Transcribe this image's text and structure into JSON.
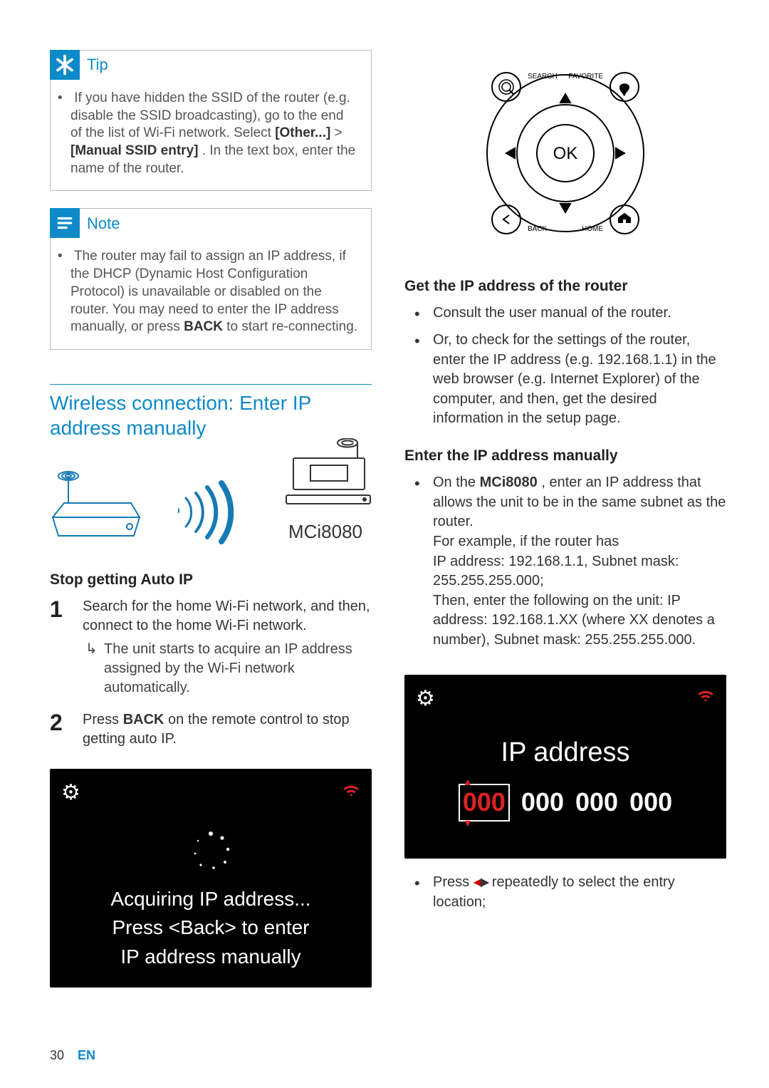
{
  "tip": {
    "title": "Tip",
    "body_parts": {
      "p1": "If you have hidden the SSID of the router (e.g. disable the SSID broadcasting), go to the end of the list of Wi-Fi network. Select ",
      "b1": "[Other...]",
      "p2": " > ",
      "b2": "[Manual SSID entry]",
      "p3": ". In the text box, enter the name of the router."
    }
  },
  "note": {
    "title": "Note",
    "body_parts": {
      "p1": "The router may fail to assign an IP address, if the DHCP (Dynamic Host Configuration Protocol) is unavailable or disabled on the router. You may need to enter the IP address manually, or press ",
      "b1": "BACK",
      "p2": " to start re-connecting."
    }
  },
  "section_title": "Wireless connection: Enter IP address manually",
  "device_label": "MCi8080",
  "stop_auto_ip": {
    "heading": "Stop getting Auto IP",
    "step1": "Search for the home Wi-Fi network, and then, connect to the home Wi-Fi network.",
    "step1_result": "The unit starts to acquire an IP address assigned by the Wi-Fi network automatically.",
    "step2_a": "Press ",
    "step2_b": "BACK",
    "step2_c": " on the remote control to stop getting auto IP."
  },
  "screen1": {
    "line1": "Acquiring IP address...",
    "line2": "Press <Back> to enter",
    "line3": "IP address manually"
  },
  "remote": {
    "search": "SEARCH",
    "favorite": "FAVORITE",
    "ok": "OK",
    "back": "BACK",
    "home": "HOME",
    "icons": {
      "search": "search-icon",
      "favorite": "heart-icon",
      "back": "back-icon",
      "home": "home-icon",
      "up": "up-arrow",
      "down": "down-arrow",
      "left": "left-arrow",
      "right": "right-arrow"
    }
  },
  "get_ip": {
    "heading": "Get the IP address of the router",
    "b1": "Consult the user manual of the router.",
    "b2": "Or, to check for the settings of the router, enter the IP address (e.g. 192.168.1.1) in the web browser (e.g. Internet Explorer) of the computer, and then, get the desired information in the setup page."
  },
  "enter_ip": {
    "heading": "Enter the IP address manually",
    "b1_a": "On the ",
    "b1_b": "MCi8080",
    "b1_c": ", enter an IP address that allows the unit to be in the same subnet as the router.",
    "p2": "For example, if the router has",
    "p3": "IP address: 192.168.1.1, Subnet mask: 255.255.255.000;",
    "p4": "Then, enter the following on the unit: IP address: 192.168.1.XX (where XX denotes a number), Subnet mask: 255.255.255.000."
  },
  "screen2": {
    "title": "IP address",
    "octets": [
      "000",
      "000",
      "000",
      "000"
    ]
  },
  "press_arrows": {
    "a": "Press ",
    "b": " repeatedly to select the entry location;"
  },
  "footer": {
    "page": "30",
    "lang": "EN"
  }
}
